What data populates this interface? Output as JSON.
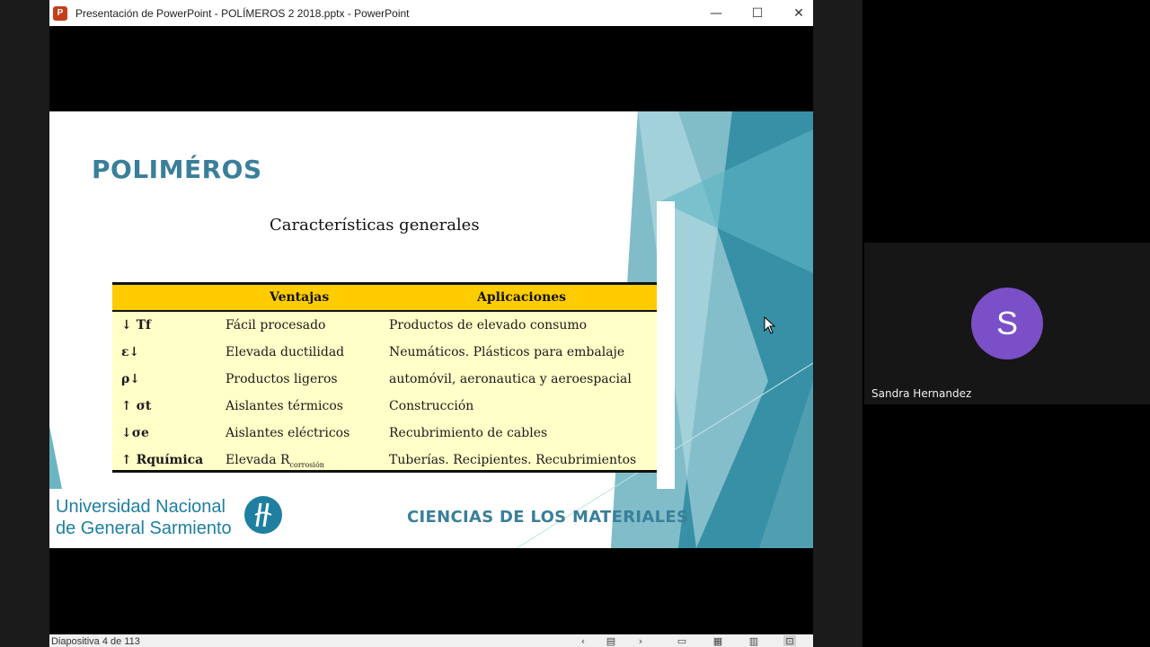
{
  "window": {
    "app_icon": "P",
    "title": "Presentación de PowerPoint  -  POLÍMEROS 2 2018.pptx - PowerPoint",
    "minimize": "—",
    "maximize": "☐",
    "close": "✕"
  },
  "slide": {
    "title": "POLIMÉROS",
    "subtitle": "Características generales",
    "table": {
      "headers": [
        "",
        "Ventajas",
        "Aplicaciones"
      ],
      "rows": [
        [
          "↓ Tf",
          "Fácil procesado",
          "Productos de elevado consumo"
        ],
        [
          "ε↓",
          "Elevada ductilidad",
          "Neumáticos. Plásticos para embalaje"
        ],
        [
          "ρ↓",
          "Productos ligeros",
          "automóvil, aeronautica y aeroespacial"
        ],
        [
          "↑ σt",
          "Aislantes térmicos",
          "Construcción"
        ],
        [
          "↓σe",
          "Aislantes eléctricos",
          "Recubrimiento de cables"
        ],
        [
          "↑ Rquímica",
          "Elevada R",
          "Tuberías. Recipientes. Recubrimientos"
        ]
      ],
      "row6_subscript": "corrosión"
    },
    "university_line1": "Universidad  Nacional",
    "university_line2": "de General Sarmiento",
    "course": "CIENCIAS DE LOS MATERIALES"
  },
  "statusbar": {
    "slide_counter": "Diapositiva 4 de 113",
    "icons": [
      "prev-icon",
      "notes-icon",
      "next-icon",
      "normal-view-icon",
      "sorter-view-icon",
      "reading-view-icon",
      "slideshow-icon"
    ]
  },
  "meeting": {
    "participant_initial": "S",
    "participant_name": "Sandra Hernandez",
    "avatar_color": "#7a4fc7"
  },
  "colors": {
    "slide_accent": "#3a7f9a",
    "table_header": "#ffcc00",
    "table_body": "#ffffc8"
  }
}
